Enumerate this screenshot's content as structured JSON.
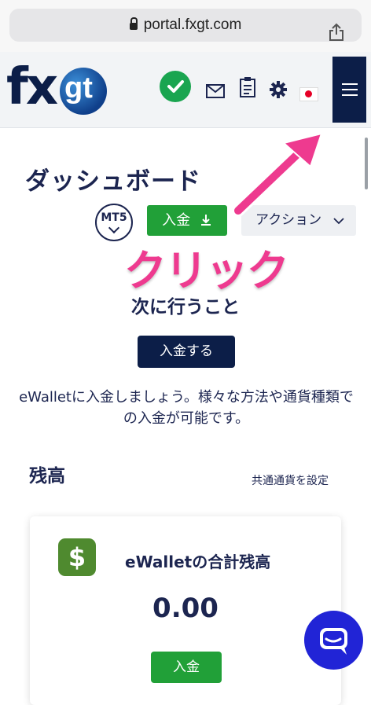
{
  "browser": {
    "url": "portal.fxgt.com"
  },
  "header": {
    "logo_fx": "fx",
    "logo_gt": "gt"
  },
  "dashboard": {
    "title": "ダッシュボード",
    "account_type": "MT5",
    "deposit_label": "入金",
    "action_label": "アクション"
  },
  "annotation": {
    "click_label": "クリック"
  },
  "next_steps": {
    "title": "次に行うこと",
    "deposit_button": "入金する",
    "description": "eWalletに入金しましょう。様々な方法や通貨種類での入金が可能です。"
  },
  "balance": {
    "title": "残高",
    "currency_link": "共通通貨を設定",
    "card": {
      "icon_symbol": "$",
      "title": "eWalletの合計残高",
      "amount": "0.00",
      "deposit_label": "入金"
    }
  },
  "colors": {
    "navy": "#0c1e48",
    "green": "#21a038",
    "pink": "#ee3a8f",
    "chat_blue": "#2124d6"
  },
  "icons": [
    "lock-icon",
    "share-icon",
    "check-circle-icon",
    "mail-icon",
    "clipboard-icon",
    "gear-icon",
    "japan-flag-icon",
    "hamburger-menu-icon",
    "download-icon",
    "chevron-down-icon",
    "dollar-icon",
    "chat-icon"
  ]
}
